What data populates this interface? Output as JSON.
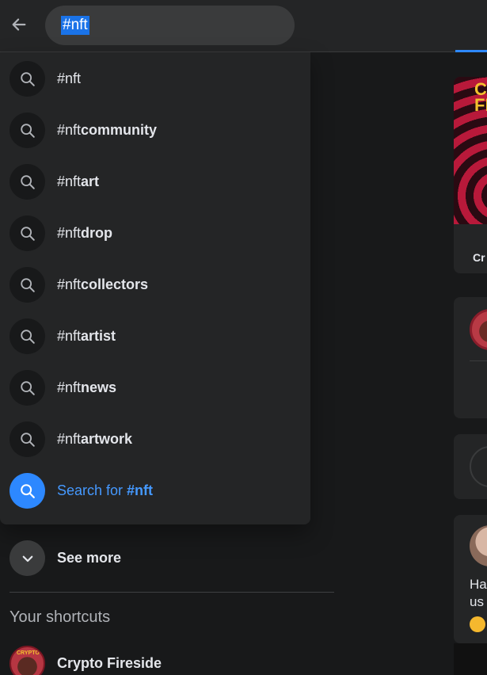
{
  "search": {
    "value": "#nft",
    "back_icon": "arrow-left-icon"
  },
  "suggestions": [
    {
      "query": "#nft",
      "rest": ""
    },
    {
      "query": "#nft",
      "rest": "community"
    },
    {
      "query": "#nft",
      "rest": "art"
    },
    {
      "query": "#nft",
      "rest": "drop"
    },
    {
      "query": "#nft",
      "rest": "collectors"
    },
    {
      "query": "#nft",
      "rest": "artist"
    },
    {
      "query": "#nft",
      "rest": "news"
    },
    {
      "query": "#nft",
      "rest": "artwork"
    }
  ],
  "search_for": {
    "prefix": "Search for ",
    "term": "#nft"
  },
  "see_more": {
    "label": "See more"
  },
  "shortcuts": {
    "title": "Your shortcuts",
    "items": [
      {
        "label": "Crypto Fireside",
        "avatar_text": "CRYPTO"
      }
    ]
  },
  "feed": {
    "card1_title": "C\nFI",
    "card1_caption": "Cr",
    "card4_text": "Ha\nus"
  },
  "colors": {
    "accent": "#2d88ff",
    "link": "#4599ff",
    "panel": "#242526",
    "bg": "#18191a"
  }
}
